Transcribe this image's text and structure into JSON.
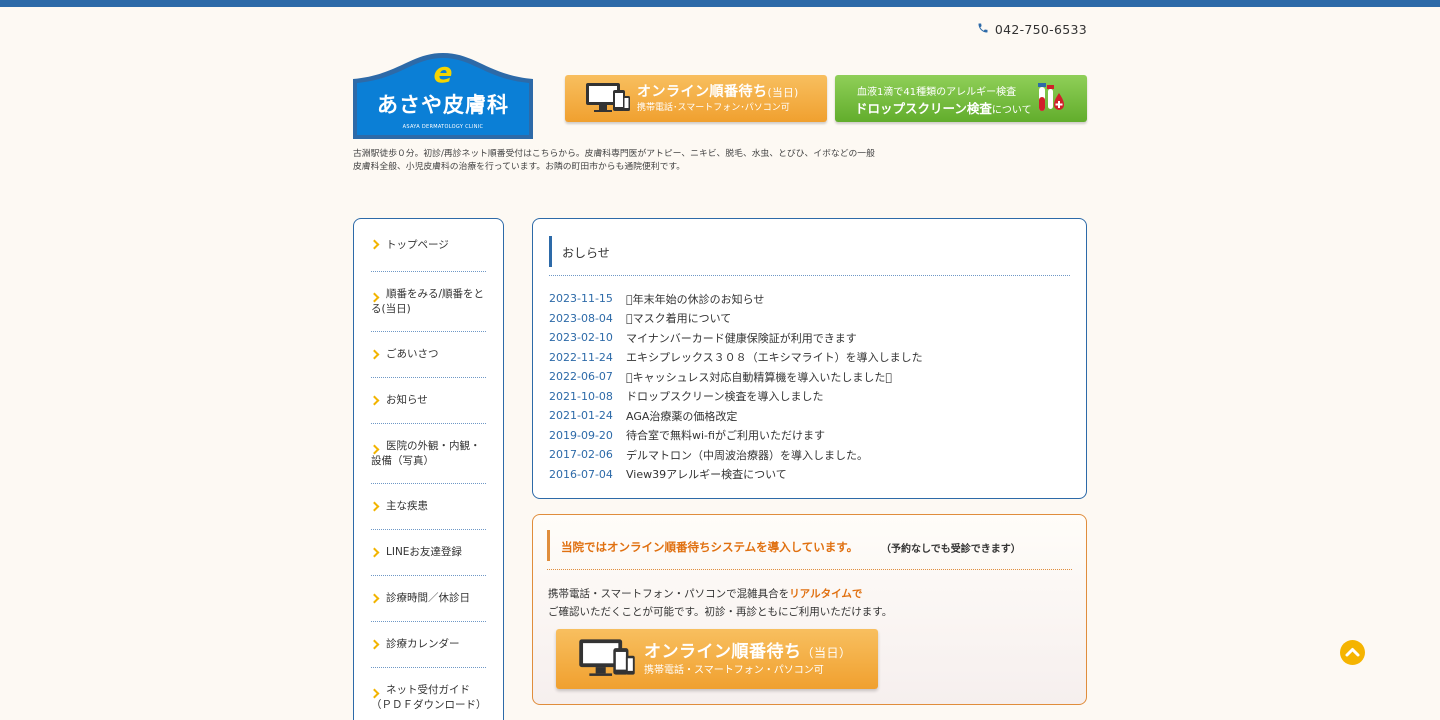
{
  "header": {
    "phone": "042-750-6533",
    "logo": {
      "mark": "e",
      "name": "あさや皮膚科",
      "sub": "ASAYA DERMATOLOGY CLINIC"
    },
    "banner_online": {
      "title": "オンライン順番待ち",
      "title_note": "(当日)",
      "sub": "携帯電話･スマートフォン･パソコン可"
    },
    "banner_allergy": {
      "line1": "血液1滴で41種類のアレルギー検査",
      "line2": "ドロップスクリーン検査",
      "line2_suffix": "について"
    },
    "intro": "古淵駅徒歩０分。初診/再診ネット順番受付はこちらから。皮膚科専門医がアトピー、ニキビ、脱毛、水虫、とびひ、イボなどの一般皮膚科全般、小児皮膚科の治療を行っています。お隣の町田市からも通院便利です。"
  },
  "sidebar": {
    "items": [
      {
        "label": "トップページ"
      },
      {
        "label": "順番をみる/順番をとる(当日)"
      },
      {
        "label": "ごあいさつ"
      },
      {
        "label": "お知らせ"
      },
      {
        "label": "医院の外観・内観・設備（写真）"
      },
      {
        "label": "主な疾患"
      },
      {
        "label": "LINEお友達登録"
      },
      {
        "label": "診療時間／休診日"
      },
      {
        "label": "診療カレンダー"
      },
      {
        "label": "ネット受付ガイド（ＰＤＦダウンロード）"
      }
    ]
  },
  "news": {
    "title": "おしらせ",
    "items": [
      {
        "date": "2023-11-15",
        "text": "􀀀年末年始の休診のお知らせ"
      },
      {
        "date": "2023-08-04",
        "text": "􀀀マスク着用について"
      },
      {
        "date": "2023-02-10",
        "text": "マイナンバーカード健康保険証が利用できます"
      },
      {
        "date": "2022-11-24",
        "text": "エキシプレックス３０８（エキシマライト）を導入しました"
      },
      {
        "date": "2022-06-07",
        "text": "􀀀キャッシュレス対応自動精算機を導入いたしました􀀀"
      },
      {
        "date": "2021-10-08",
        "text": "ドロップスクリーン検査を導入しました"
      },
      {
        "date": "2021-01-24",
        "text": "AGA治療薬の価格改定"
      },
      {
        "date": "2019-09-20",
        "text": "待合室で無料wi-fiがご利用いただけます"
      },
      {
        "date": "2017-02-06",
        "text": "デルマトロン（中周波治療器）を導入しました。"
      },
      {
        "date": "2016-07-04",
        "text": "View39アレルギー検査について"
      }
    ]
  },
  "notice": {
    "title": "当院ではオンライン順番待ちシステムを導入しています。",
    "note": "（予約なしでも受診できます）",
    "body_line1_pre": "携帯電話・スマートフォン・パソコンで混雑具合を",
    "body_line1_hl": "リアルタイムで",
    "body_line2": "ご確認いただくことが可能です。初診・再診ともにご利用いただけます。",
    "banner": {
      "title": "オンライン順番待ち",
      "title_note": "（当日）",
      "sub": "携帯電話・スマートフォン・パソコン可"
    }
  },
  "icons": {
    "phone": "phone-icon",
    "devices": "devices-icon",
    "test_tubes": "test-tubes-icon",
    "chevron": "chevron-right-icon",
    "back_to_top": "chevron-up-icon"
  },
  "colors": {
    "accent_blue": "#2d6aa8",
    "accent_orange": "#f0a02f",
    "accent_green": "#62ad2c",
    "notice_orange": "#e07010",
    "background": "#fdf9f3"
  }
}
